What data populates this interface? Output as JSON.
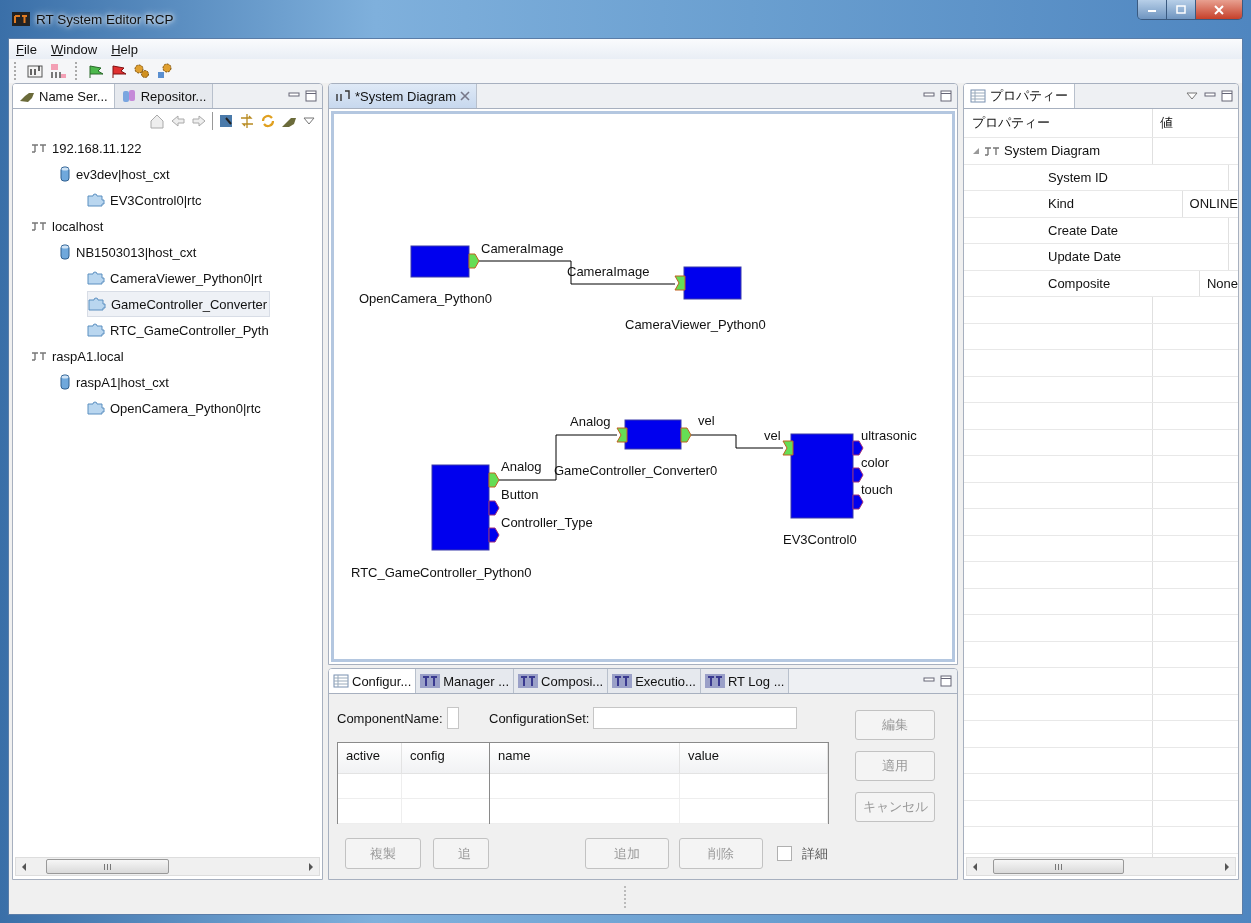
{
  "window": {
    "title": "RT System Editor RCP"
  },
  "menu": [
    "File",
    "Window",
    "Help"
  ],
  "name_service": {
    "tabs": [
      {
        "label": "Name Ser...",
        "selected": true
      },
      {
        "label": "Repositor...",
        "selected": false
      }
    ],
    "tree": [
      {
        "label": "192.168.11.122",
        "kind": "host",
        "selected": false,
        "children": [
          {
            "label": "ev3dev|host_cxt",
            "kind": "context",
            "selected": false,
            "children": [
              {
                "label": "EV3Control0|rtc",
                "kind": "rtc",
                "selected": false
              }
            ]
          }
        ]
      },
      {
        "label": "localhost",
        "kind": "host",
        "selected": false,
        "children": [
          {
            "label": "NB1503013|host_cxt",
            "kind": "context",
            "selected": false,
            "children": [
              {
                "label": "CameraViewer_Python0|rt",
                "kind": "rtc",
                "selected": false
              },
              {
                "label": "GameController_Converter",
                "kind": "rtc",
                "selected": true
              },
              {
                "label": "RTC_GameController_Pyth",
                "kind": "rtc",
                "selected": false
              }
            ]
          }
        ]
      },
      {
        "label": "raspA1.local",
        "kind": "host",
        "selected": false,
        "children": [
          {
            "label": "raspA1|host_cxt",
            "kind": "context",
            "selected": false,
            "children": [
              {
                "label": "OpenCamera_Python0|rtc",
                "kind": "rtc",
                "selected": false
              }
            ]
          }
        ]
      }
    ]
  },
  "editor": {
    "tab": {
      "label": "*System Diagram",
      "selected": true
    },
    "components": [
      {
        "name": "OpenCamera_Python0",
        "ports": [
          {
            "name": "CameraImage",
            "kind": "out",
            "connected": true
          }
        ]
      },
      {
        "name": "CameraViewer_Python0",
        "ports": [
          {
            "name": "CameraImage",
            "kind": "in",
            "connected": true
          }
        ]
      },
      {
        "name": "GameController_Converter0",
        "ports": [
          {
            "name": "Analog",
            "kind": "in",
            "connected": true
          },
          {
            "name": "vel",
            "kind": "out",
            "connected": true
          }
        ]
      },
      {
        "name": "EV3Control0",
        "ports": [
          {
            "name": "vel",
            "kind": "in",
            "connected": true
          },
          {
            "name": "ultrasonic",
            "kind": "out",
            "connected": false
          },
          {
            "name": "color",
            "kind": "out",
            "connected": false
          },
          {
            "name": "touch",
            "kind": "out",
            "connected": false
          }
        ]
      },
      {
        "name": "RTC_GameController_Python0",
        "ports": [
          {
            "name": "Analog",
            "kind": "out",
            "connected": true
          },
          {
            "name": "Button",
            "kind": "out",
            "connected": false
          },
          {
            "name": "Controller_Type",
            "kind": "out",
            "connected": false
          }
        ]
      }
    ]
  },
  "configuration": {
    "tabs": [
      {
        "label": "Configur...",
        "kind": "table",
        "selected": true
      },
      {
        "label": "Manager ...",
        "kind": "rt",
        "selected": false
      },
      {
        "label": "Composi...",
        "kind": "rt",
        "selected": false
      },
      {
        "label": "Executio...",
        "kind": "rt",
        "selected": false
      },
      {
        "label": "RT Log ...",
        "kind": "rt",
        "selected": false
      }
    ],
    "component_name_label": "ComponentName:",
    "configuration_set_label": "ConfigurationSet:",
    "left_columns": [
      "active",
      "config"
    ],
    "right_columns": [
      "name",
      "value"
    ],
    "side_buttons": [
      {
        "label": "編集",
        "disabled": true
      },
      {
        "label": "適用",
        "disabled": true
      },
      {
        "label": "キャンセル",
        "disabled": true
      }
    ],
    "left_buttons": [
      {
        "label": "複製",
        "disabled": true
      },
      {
        "label": "追",
        "disabled": true
      }
    ],
    "right_buttons": [
      {
        "label": "追加",
        "disabled": true
      },
      {
        "label": "削除",
        "disabled": true
      }
    ],
    "detail": {
      "label": "詳細",
      "checked": false
    }
  },
  "properties": {
    "tab": {
      "label": "プロパティー",
      "selected": true
    },
    "columns": [
      "プロパティー",
      "値"
    ],
    "rows": [
      {
        "label": "System Diagram",
        "kind": "group",
        "expanded": true
      },
      {
        "label": "System ID",
        "kind": "field"
      },
      {
        "label": "Kind",
        "kind": "field",
        "value": "ONLINE"
      },
      {
        "label": "Create Date",
        "kind": "field"
      },
      {
        "label": "Update Date",
        "kind": "field"
      },
      {
        "label": "Composite",
        "kind": "field",
        "value": "None"
      }
    ]
  }
}
